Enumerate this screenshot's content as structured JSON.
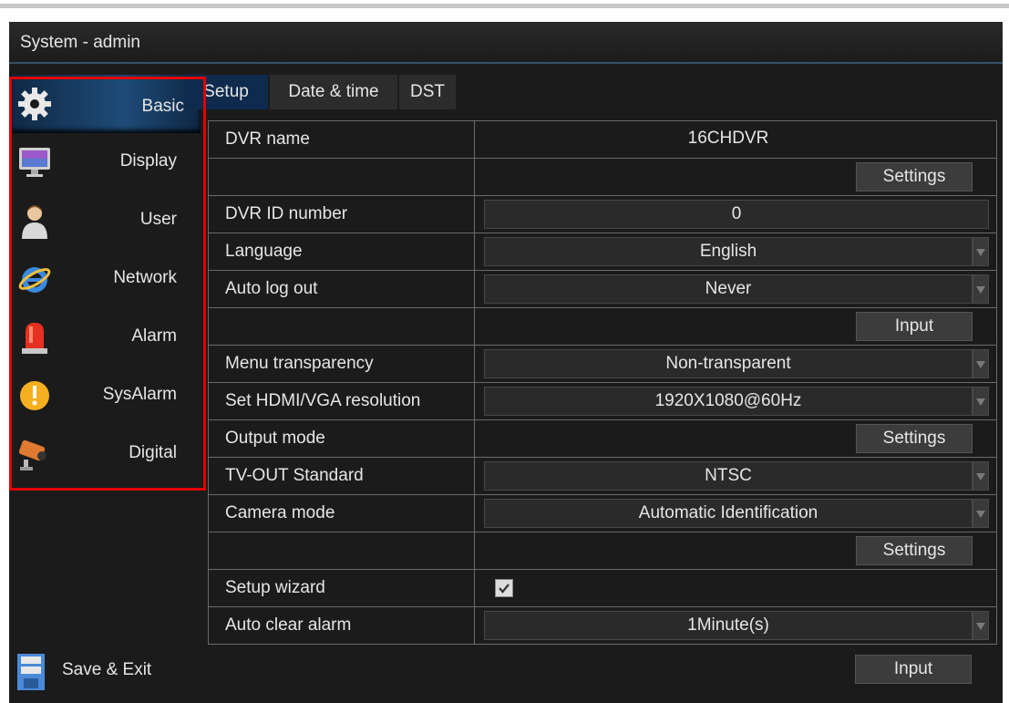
{
  "window": {
    "title": "System - admin"
  },
  "sidebar": {
    "items": [
      {
        "label": "Basic",
        "icon": "gear-icon"
      },
      {
        "label": "Display",
        "icon": "monitor-icon"
      },
      {
        "label": "User",
        "icon": "user-icon"
      },
      {
        "label": "Network",
        "icon": "network-icon"
      },
      {
        "label": "Alarm",
        "icon": "alarm-light-icon"
      },
      {
        "label": "SysAlarm",
        "icon": "warning-icon"
      },
      {
        "label": "Digital",
        "icon": "camera-icon"
      }
    ],
    "save_exit": {
      "label": "Save & Exit",
      "icon": "save-icon"
    }
  },
  "tabs": [
    {
      "label": "Setup",
      "active": true
    },
    {
      "label": "Date & time",
      "active": false
    },
    {
      "label": "DST",
      "active": false
    }
  ],
  "settings": {
    "dvr_name": {
      "label": "DVR name",
      "value": "16CHDVR"
    },
    "dvr_name_settings_btn": "Settings",
    "dvr_id": {
      "label": "DVR ID number",
      "value": "0"
    },
    "language": {
      "label": "Language",
      "value": "English"
    },
    "auto_log_out": {
      "label": "Auto log out",
      "value": "Never"
    },
    "auto_log_out_input_btn": "Input",
    "menu_transparency": {
      "label": "Menu transparency",
      "value": "Non-transparent"
    },
    "resolution": {
      "label": "Set HDMI/VGA resolution",
      "value": "1920X1080@60Hz"
    },
    "output_mode": {
      "label": "Output mode",
      "button": "Settings"
    },
    "tv_out": {
      "label": "TV-OUT Standard",
      "value": "NTSC"
    },
    "camera_mode": {
      "label": "Camera mode",
      "value": "Automatic Identification"
    },
    "camera_mode_settings_btn": "Settings",
    "setup_wizard": {
      "label": "Setup wizard",
      "checked": true
    },
    "auto_clear_alarm": {
      "label": "Auto clear alarm",
      "value": "1Minute(s)"
    },
    "auto_clear_alarm_input_btn": "Input"
  },
  "colors": {
    "background": "#1b1b1b",
    "active_item": "#1e4b78",
    "highlight_box": "#e00000"
  }
}
